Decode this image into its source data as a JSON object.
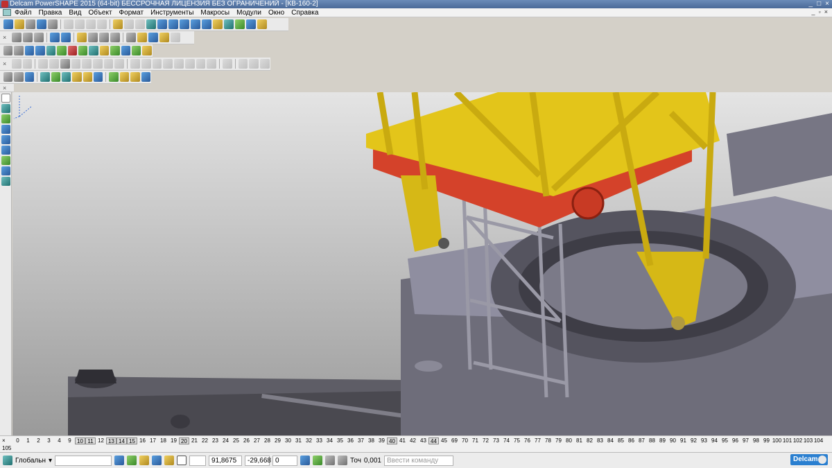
{
  "window": {
    "title": "Delcam PowerSHAPE 2015 (64-bit) БЕССРОЧНАЯ ЛИЦЕНЗИЯ БЕЗ ОГРАНИЧЕНИЙ - [КВ-160-2]",
    "controls": [
      "_",
      "□",
      "×"
    ]
  },
  "menu": {
    "items": [
      "Файл",
      "Правка",
      "Вид",
      "Объект",
      "Формат",
      "Инструменты",
      "Макросы",
      "Модули",
      "Окно",
      "Справка"
    ],
    "mdi_controls": [
      "_",
      "▫",
      "×"
    ]
  },
  "levels": {
    "close": "×",
    "items": [
      "0",
      "1",
      "2",
      "3",
      "4",
      "9",
      "10",
      "11",
      "12",
      "13",
      "14",
      "15",
      "16",
      "17",
      "18",
      "19",
      "20",
      "21",
      "22",
      "23",
      "24",
      "25",
      "26",
      "27",
      "28",
      "29",
      "30",
      "31",
      "32",
      "33",
      "34",
      "35",
      "36",
      "37",
      "38",
      "39",
      "40",
      "41",
      "42",
      "43",
      "44",
      "45",
      "69",
      "70",
      "71",
      "72",
      "73",
      "74",
      "75",
      "76",
      "77",
      "78",
      "79",
      "80",
      "81",
      "82",
      "83",
      "84",
      "85",
      "86",
      "87",
      "88",
      "89",
      "90",
      "91",
      "92",
      "93",
      "94",
      "95",
      "96",
      "97",
      "98",
      "99",
      "100",
      "101",
      "102",
      "103",
      "104"
    ],
    "active": [
      "10",
      "11",
      "13",
      "14",
      "15",
      "20",
      "40",
      "44"
    ],
    "extra": "105"
  },
  "status": {
    "workplane": "Глобальн",
    "coord_x": "91,8675",
    "coord_y": "-29,668",
    "coord_z": "0",
    "tolerance_label": "Точ",
    "tolerance": "0,001",
    "command_placeholder": "Ввести команду"
  },
  "brand": {
    "logo_text": "Delcam"
  },
  "colors": {
    "accent_yellow": "#e3c51a",
    "accent_red": "#d4422a",
    "steel": "#8f8ea0"
  }
}
